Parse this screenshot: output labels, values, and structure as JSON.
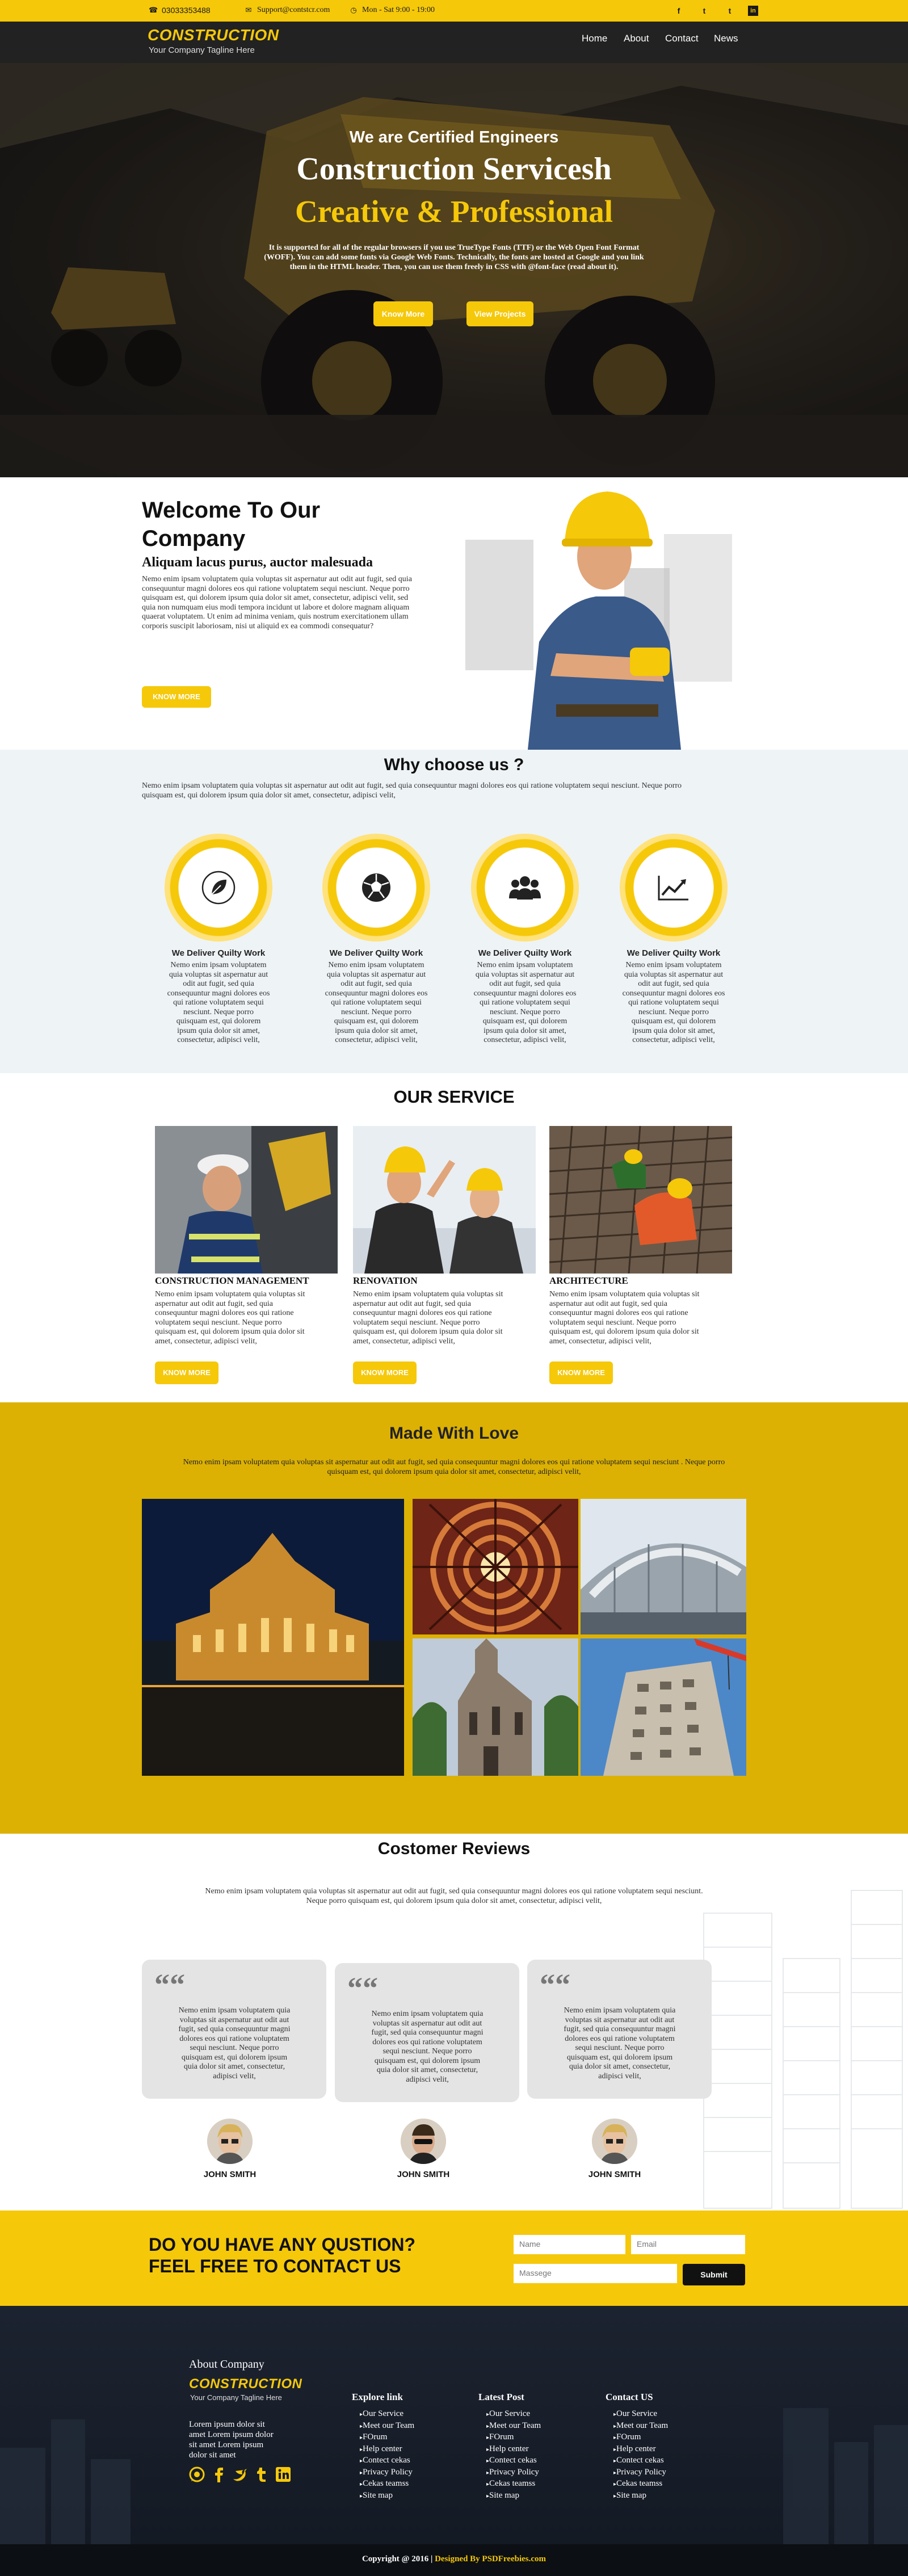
{
  "topbar": {
    "phone": "03033353488",
    "email": "Support@contstcr.com",
    "hours": "Mon - Sat 9:00 - 19:00",
    "social": [
      "f",
      "t",
      "t",
      "in"
    ]
  },
  "nav": {
    "logo": "CONSTRUCTION",
    "tagline": "Your Company Tagline Here",
    "links": [
      "Home",
      "About",
      "Contact",
      "News"
    ]
  },
  "hero": {
    "pretitle": "We are Certified Engineers",
    "title": "Construction Servicesh",
    "subtitle": "Creative & Professional",
    "text1": "It is supported for all of the regular browsers if you use TrueType Fonts (TTF) or the Web Open Font Format",
    "text2": "(WOFF). You can add some fonts via Google Web Fonts. Technically, the fonts are hosted at Google and you link",
    "text3": "them in the HTML header. Then, you can use them freely in CSS with @font-face (read about it).",
    "btn1": "Know More",
    "btn2": "View Projects"
  },
  "welcome": {
    "title1": "Welcome To Our",
    "title2": "Company",
    "subtitle": "Aliquam lacus purus, auctor malesuada",
    "lines": [
      "Nemo enim ipsam voluptatem quia voluptas sit aspernatur aut odit aut fugit, sed quia",
      "consequuntur magni dolores eos qui ratione voluptatem sequi nesciunt. Neque porro",
      "quisquam est, qui dolorem ipsum quia dolor sit amet, consectetur, adipisci velit, sed",
      "quia non numquam eius modi tempora incidunt ut labore et dolore magnam aliquam",
      "quaerat voluptatem. Ut enim ad minima veniam, quis nostrum exercitationem ullam",
      "corporis suscipit laboriosam, nisi ut aliquid ex ea commodi consequatur?"
    ],
    "button": "KNOW MORE"
  },
  "why": {
    "title": "Why choose us ?",
    "intro1": "Nemo enim ipsam voluptatem quia voluptas sit aspernatur aut odit aut fugit, sed quia consequuntur magni dolores eos qui ratione voluptatem sequi nesciunt. Neque porro",
    "intro2": "quisquam est, qui dolorem ipsum quia dolor sit amet, consectetur, adipisci velit,",
    "features": [
      {
        "icon": "leaf-icon",
        "title": "We Deliver Quilty Work"
      },
      {
        "icon": "soccer-ball-icon",
        "title": "We Deliver Quilty Work"
      },
      {
        "icon": "users-icon",
        "title": "We Deliver Quilty Work"
      },
      {
        "icon": "chart-icon",
        "title": "We Deliver Quilty Work"
      }
    ],
    "feature_lines": [
      "Nemo enim ipsam voluptatem",
      "quia voluptas sit aspernatur aut",
      "odit aut fugit, sed quia",
      "consequuntur magni dolores eos",
      "qui ratione voluptatem sequi",
      "nesciunt. Neque porro",
      "quisquam est, qui dolorem",
      "ipsum quia dolor sit amet,",
      "consectetur, adipisci velit,"
    ]
  },
  "service": {
    "title": "OUR SERVICE",
    "items": [
      {
        "title": "CONSTRUCTION MANAGEMENT",
        "button": "KNOW MORE"
      },
      {
        "title": "RENOVATION",
        "button": "KNOW MORE"
      },
      {
        "title": "ARCHITECTURE",
        "button": "KNOW MORE"
      }
    ],
    "lines": [
      "Nemo enim ipsam voluptatem quia voluptas sit",
      "aspernatur aut odit aut fugit, sed quia",
      "consequuntur magni dolores eos qui ratione",
      "voluptatem sequi nesciunt. Neque porro",
      "quisquam est, qui dolorem ipsum quia dolor sit",
      "amet, consectetur, adipisci velit,"
    ]
  },
  "love": {
    "title": "Made With Love",
    "text1": "Nemo enim ipsam voluptatem quia voluptas sit aspernatur aut odit aut fugit, sed quia consequuntur magni dolores eos qui ratione voluptatem sequi nesciunt . Neque porro",
    "text2": "quisquam est, qui dolorem ipsum quia dolor sit amet, consectetur, adipisci velit,"
  },
  "reviews": {
    "title": "Costomer Reviews",
    "text1": "Nemo enim ipsam voluptatem quia voluptas sit aspernatur aut odit aut fugit, sed quia consequuntur magni dolores eos qui ratione voluptatem sequi nesciunt.",
    "text2": "Neque porro quisquam est, qui dolorem ipsum quia dolor sit amet, consectetur, adipisci velit,",
    "card_lines": [
      "Nemo enim ipsam voluptatem quia",
      "voluptas sit aspernatur aut odit aut",
      "fugit, sed quia consequuntur magni",
      "dolores eos qui ratione voluptatem",
      "sequi nesciunt. Neque porro",
      "quisquam est, qui dolorem ipsum",
      "quia dolor sit amet, consectetur,",
      "adipisci velit,"
    ],
    "names": [
      "JOHN SMITH",
      "JOHN SMITH",
      "JOHN SMITH"
    ]
  },
  "contact": {
    "line1": "DO YOU HAVE ANY QUSTION?",
    "line2": "FEEL FREE TO CONTACT US",
    "name_placeholder": "Name",
    "email_placeholder": "Email",
    "message_placeholder": "Massege",
    "submit": "Submit"
  },
  "footer": {
    "about_title": "About Company",
    "logo": "CONSTRUCTION",
    "tagline": "Your Company Tagline Here",
    "about_lines": [
      "Lorem ipsum dolor sit",
      "amet Lorem ipsum dolor",
      "sit amet Lorem ipsum",
      "dolor sit amet"
    ],
    "col1_title": "Explore link",
    "col2_title": "Latest Post",
    "col3_title": "Contact US",
    "links": [
      "Our Service",
      "Meet our Team",
      "FOrum",
      "Help center",
      "Contect cekas",
      "Privacy Policy",
      "Cekas teamss",
      "Site map"
    ],
    "copyright": "Copyright @ 2016",
    "designed": "Designed By PSDFreebies.com"
  },
  "colors": {
    "accent": "#f5c80a",
    "dark": "#222222",
    "footer": "#161c27"
  }
}
